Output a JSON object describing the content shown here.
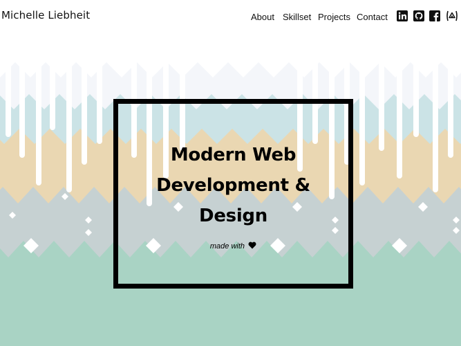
{
  "header": {
    "logo": "Michelle Liebheit",
    "nav": [
      {
        "label": "About"
      },
      {
        "label": "Skillset"
      },
      {
        "label": "Projects"
      },
      {
        "label": "Contact"
      }
    ],
    "social": [
      "linkedin-icon",
      "github-icon",
      "facebook-icon",
      "codepen-icon"
    ]
  },
  "hero": {
    "headline_line1": "Modern Web",
    "headline_line2": "Development &",
    "headline_line3": "Design",
    "made_with": "made with",
    "heart_icon": "heart-icon"
  },
  "colors": {
    "text": "#111111",
    "frame": "#000000",
    "band_white": "#f4f6fa",
    "band_blue": "#cbe3e6",
    "band_peach": "#ead7b2",
    "band_gray": "#c6d1d2",
    "band_green": "#a9d3c4"
  }
}
